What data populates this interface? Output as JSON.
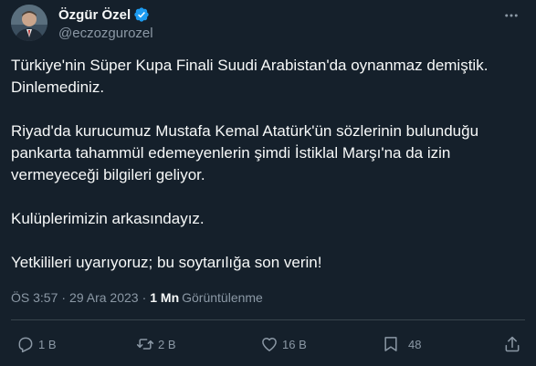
{
  "author": {
    "display_name": "Özgür Özel",
    "handle": "@eczozgurozel",
    "verified": true
  },
  "tweet": {
    "paragraphs": [
      "Türkiye'nin Süper Kupa Finali Suudi Arabistan'da oynanmaz demiştik.\nDinlemediniz.",
      "Riyad'da kurucumuz Mustafa Kemal Atatürk'ün sözlerinin bulunduğu\npankarta tahammül edemeyenlerin şimdi İstiklal Marşı'na da izin\nvermeyeceği bilgileri geliyor.",
      "Kulüplerimizin arkasındayız.",
      "Yetkilileri uyarıyoruz; bu soytarılığa son verin!"
    ],
    "time": "ÖS 3:57",
    "separator": "·",
    "date": "29 Ara 2023",
    "views_count": "1 Mn",
    "views_label": "Görüntülenme"
  },
  "actions": {
    "replies": "1 B",
    "retweets": "2 B",
    "likes": "16 B",
    "bookmarks": "48"
  },
  "icons": {
    "verified": "verified-badge-icon",
    "more": "more-icon",
    "reply": "reply-icon",
    "retweet": "retweet-icon",
    "like": "heart-icon",
    "bookmark": "bookmark-icon",
    "share": "share-icon"
  },
  "colors": {
    "background": "#15202b",
    "text": "#f7f9f9",
    "secondary": "#8b98a5",
    "verified": "#1d9bf0",
    "divider": "#38444d"
  }
}
